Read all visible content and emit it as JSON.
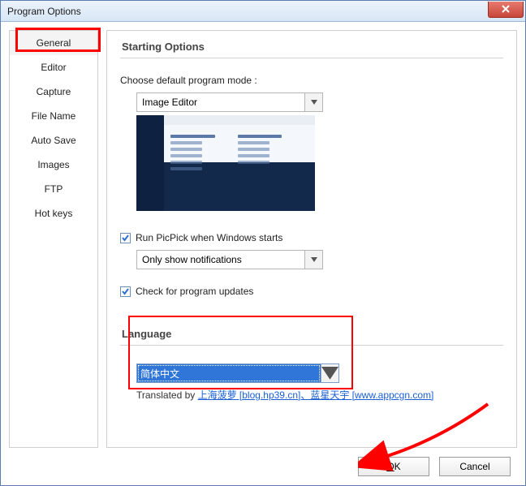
{
  "window": {
    "title": "Program Options"
  },
  "nav": {
    "items": [
      {
        "label": "General"
      },
      {
        "label": "Editor"
      },
      {
        "label": "Capture"
      },
      {
        "label": "File Name"
      },
      {
        "label": "Auto Save"
      },
      {
        "label": "Images"
      },
      {
        "label": "FTP"
      },
      {
        "label": "Hot keys"
      }
    ],
    "selected_index": 0
  },
  "panel": {
    "starting": {
      "title": "Starting Options",
      "choose_label": "Choose default program mode :",
      "mode_select": {
        "value": "Image Editor"
      },
      "run_checkbox": {
        "checked": true,
        "label": "Run PicPick when Windows starts"
      },
      "startup_select": {
        "value": "Only show notifications"
      },
      "updates_checkbox": {
        "checked": true,
        "label": "Check for program updates"
      }
    },
    "language": {
      "title": "Language",
      "select": {
        "value": "简体中文"
      },
      "translated_prefix": "Translated by ",
      "translated_links": "上海菠萝 [blog.hp39.cn]、蓝星天宇 [www.appcgn.com]"
    }
  },
  "footer": {
    "ok_prefix": "O",
    "ok_suffix": "K",
    "cancel": "Cancel"
  }
}
